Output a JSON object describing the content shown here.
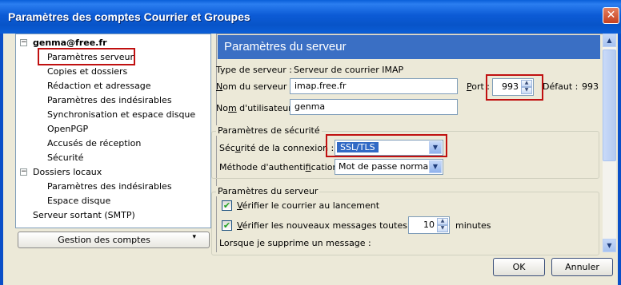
{
  "window": {
    "title": "Paramètres des comptes Courrier et Groupes",
    "close_glyph": "✕"
  },
  "tree": {
    "items": [
      {
        "label": "genma@free.fr",
        "level": 0,
        "toggle": "−",
        "bold": true
      },
      {
        "label": "Paramètres serveur",
        "level": 1,
        "selected": true
      },
      {
        "label": "Copies et dossiers",
        "level": 1
      },
      {
        "label": "Rédaction et adressage",
        "level": 1
      },
      {
        "label": "Paramètres des indésirables",
        "level": 1
      },
      {
        "label": "Synchronisation et espace disque",
        "level": 1
      },
      {
        "label": "OpenPGP",
        "level": 1
      },
      {
        "label": "Accusés de réception",
        "level": 1
      },
      {
        "label": "Sécurité",
        "level": 1
      },
      {
        "label": "Dossiers locaux",
        "level": 0,
        "toggle": "−"
      },
      {
        "label": "Paramètres des indésirables",
        "level": 1
      },
      {
        "label": "Espace disque",
        "level": 1
      },
      {
        "label": "Serveur sortant (SMTP)",
        "level": 0
      }
    ],
    "manage_button": "Gestion des comptes",
    "manage_caret": "▾"
  },
  "server": {
    "header": "Paramètres du serveur",
    "type_label": "Type de serveur :",
    "type_value": "Serveur de courrier IMAP",
    "name_label_underlined": "N",
    "name_label_rest": "om du serveur :",
    "name_value": "imap.free.fr",
    "port_label_rest": "ort :",
    "port_label_underlined": "P",
    "port_value": "993",
    "default_label": "Défaut :",
    "default_value": "993",
    "user_label_pre": "No",
    "user_label_underlined": "m",
    "user_label_rest": " d'utilisateur :",
    "user_value": "genma"
  },
  "security": {
    "group_title": "Paramètres de sécurité",
    "conn_label_pre": "Séc",
    "conn_label_underlined": "u",
    "conn_label_rest": "rité de la connexion :",
    "conn_value": "SSL/TLS",
    "auth_label_pre": "Méthode d'authenti",
    "auth_label_underlined": "f",
    "auth_label_rest": "ication :",
    "auth_value": "Mot de passe normal"
  },
  "server_settings": {
    "group_title": "Paramètres du serveur",
    "check_launch_underlined": "V",
    "check_launch_rest": "érifier le courrier au lancement",
    "check_new_underlined": "V",
    "check_new_rest": "érifier les nouveaux messages toutes les",
    "interval_value": "10",
    "interval_unit": "minutes",
    "delete_label": "Lorsque je supprime un message :"
  },
  "buttons": {
    "ok": "OK",
    "cancel": "Annuler"
  },
  "colors": {
    "titlebar": "#0A5FD8",
    "header": "#3A6FC4",
    "highlight": "#C01010",
    "selection": "#316AC5"
  }
}
